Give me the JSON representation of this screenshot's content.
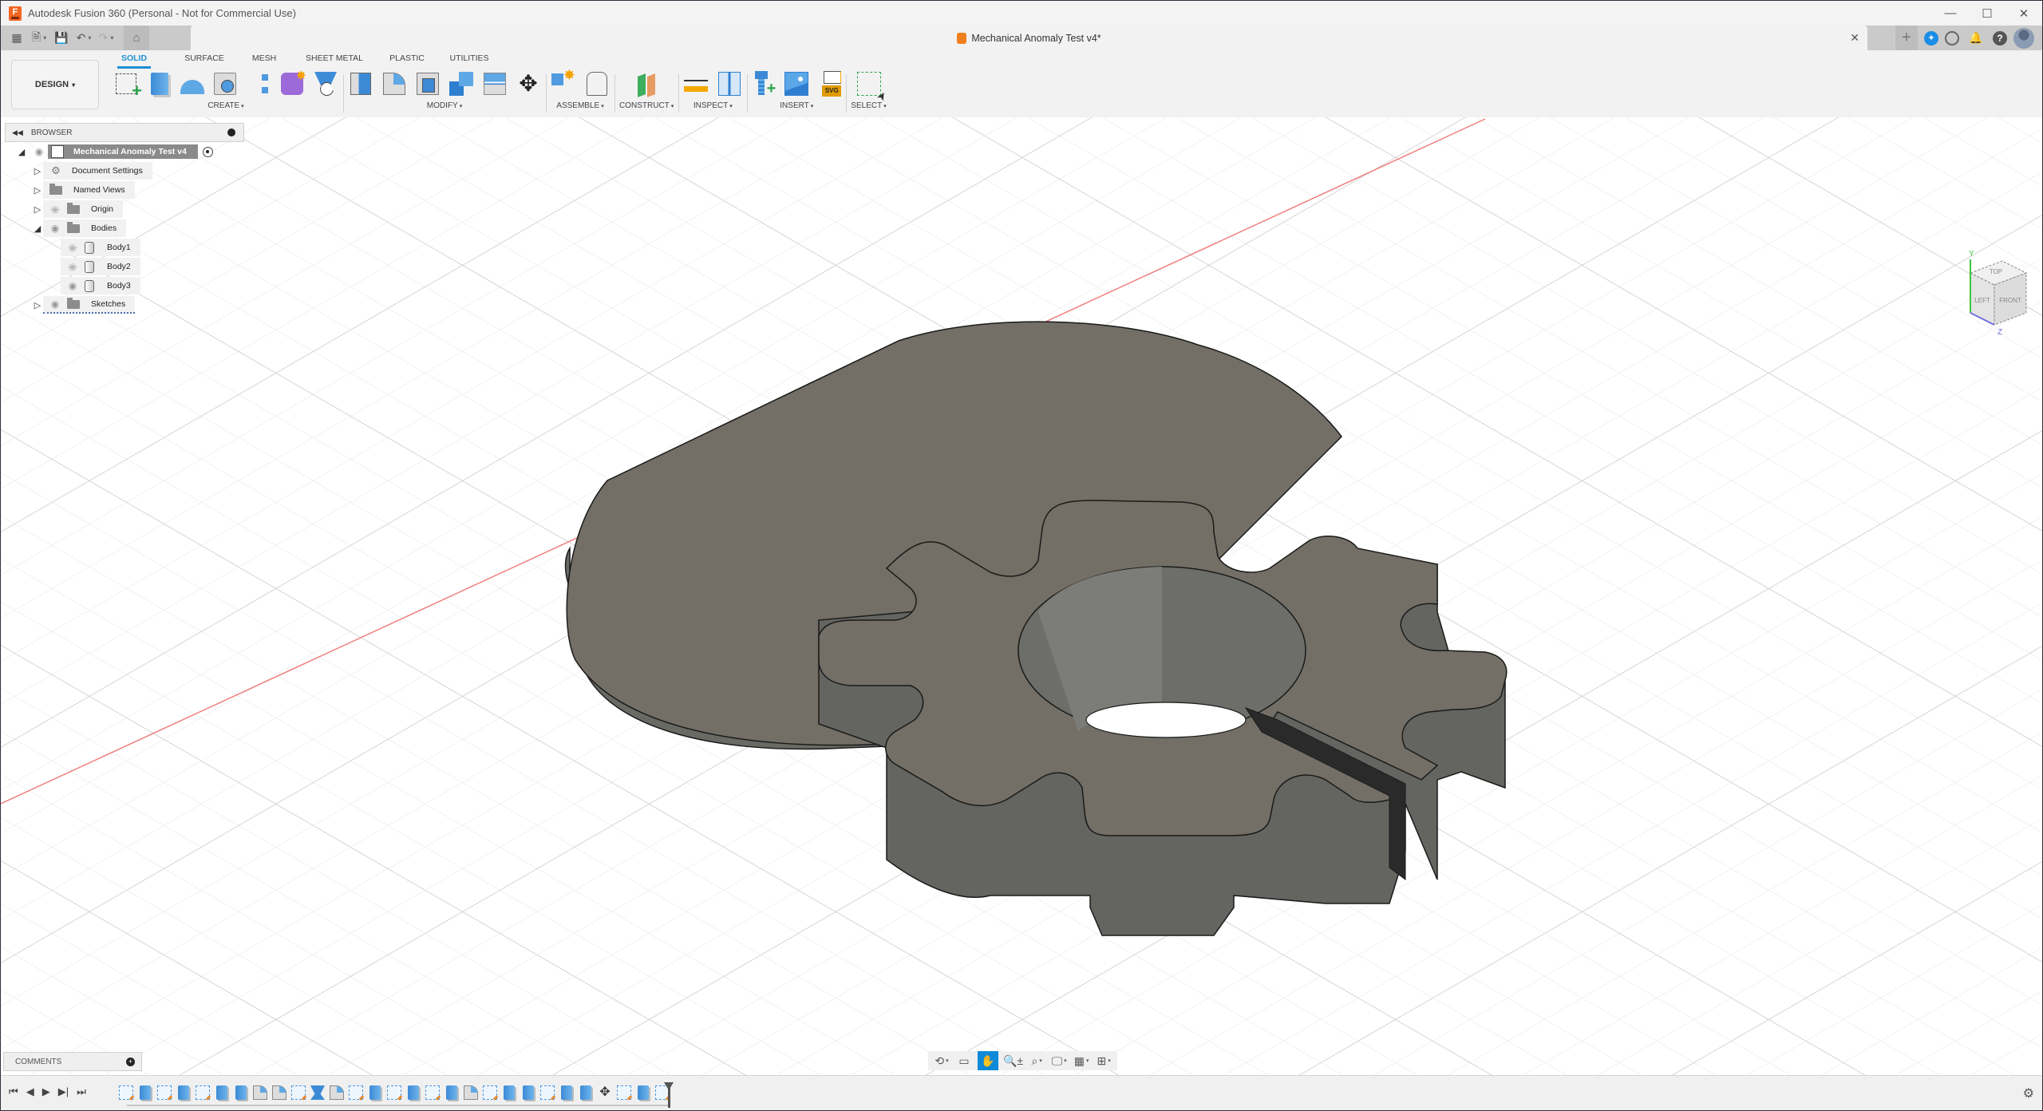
{
  "app": {
    "title": "Autodesk Fusion 360 (Personal - Not for Commercial Use)",
    "logo_letter": "F"
  },
  "window_controls": {
    "minimize": "—",
    "maximize": "☐",
    "close": "✕"
  },
  "qat": {
    "grid_icon": "▦",
    "file_icon": "🗎",
    "save_icon": "💾",
    "undo_icon": "↶",
    "redo_icon": "↷",
    "home_icon": "⌂",
    "dropdown": "▾"
  },
  "document_tab": {
    "title": "Mechanical Anomaly Test v4*",
    "close": "✕"
  },
  "qat_right": {
    "new_tab": "+",
    "extensions": "✦",
    "job_status": "◷",
    "notifications": "🔔",
    "help": "?"
  },
  "workspace": {
    "label": "DESIGN",
    "dropdown": "▾"
  },
  "ribbon_tabs": [
    {
      "label": "SOLID",
      "active": true
    },
    {
      "label": "SURFACE",
      "active": false
    },
    {
      "label": "MESH",
      "active": false
    },
    {
      "label": "SHEET METAL",
      "active": false
    },
    {
      "label": "PLASTIC",
      "active": false
    },
    {
      "label": "UTILITIES",
      "active": false
    }
  ],
  "ribbon_groups": [
    {
      "label": "CREATE",
      "tools": [
        "create-sketch",
        "extrude",
        "revolve",
        "hole",
        "rectangular-pattern",
        "create-form",
        "loft"
      ]
    },
    {
      "label": "MODIFY",
      "tools": [
        "press-pull",
        "fillet",
        "shell",
        "combine",
        "split-body",
        "move-copy"
      ]
    },
    {
      "label": "ASSEMBLE",
      "tools": [
        "new-component",
        "as-built-joint"
      ]
    },
    {
      "label": "CONSTRUCT",
      "tools": [
        "offset-plane"
      ]
    },
    {
      "label": "INSPECT",
      "tools": [
        "measure",
        "section-analysis"
      ]
    },
    {
      "label": "INSERT",
      "tools": [
        "insert-mcmaster-carr",
        "canvas",
        "insert-svg"
      ]
    },
    {
      "label": "SELECT",
      "tools": [
        "window-select"
      ]
    }
  ],
  "browser": {
    "title": "BROWSER",
    "root": {
      "label": "Mechanical Anomaly Test v4",
      "expanded": true,
      "visible": true
    },
    "items": [
      {
        "label": "Document Settings",
        "type": "settings",
        "expanded": false
      },
      {
        "label": "Named Views",
        "type": "folder",
        "expanded": false
      },
      {
        "label": "Origin",
        "type": "folder",
        "expanded": false,
        "visible": false
      },
      {
        "label": "Bodies",
        "type": "folder",
        "expanded": true,
        "visible": true,
        "children": [
          {
            "label": "Body1",
            "visible": false
          },
          {
            "label": "Body2",
            "visible": false
          },
          {
            "label": "Body3",
            "visible": true
          }
        ]
      },
      {
        "label": "Sketches",
        "type": "folder",
        "expanded": false,
        "visible": true
      }
    ]
  },
  "viewcube": {
    "top": "TOP",
    "left": "LEFT",
    "front": "FRONT",
    "axis_y": "Y",
    "axis_z": "Z"
  },
  "comments": {
    "label": "COMMENTS",
    "add": "+"
  },
  "nav_toolbar": {
    "tools": [
      {
        "name": "orbit",
        "glyph": "⟲",
        "dropdown": true,
        "active": false
      },
      {
        "name": "look-at",
        "glyph": "▭",
        "dropdown": false,
        "active": false
      },
      {
        "name": "pan",
        "glyph": "✋",
        "dropdown": false,
        "active": true
      },
      {
        "name": "zoom",
        "glyph": "🔍±",
        "dropdown": false,
        "active": false
      },
      {
        "name": "fit",
        "glyph": "⌕",
        "dropdown": true,
        "active": false
      },
      {
        "name": "display-settings",
        "glyph": "🖵",
        "dropdown": true,
        "active": false
      },
      {
        "name": "grid-snaps",
        "glyph": "▦",
        "dropdown": true,
        "active": false
      },
      {
        "name": "viewports",
        "glyph": "⊞",
        "dropdown": true,
        "active": false
      }
    ]
  },
  "timeline": {
    "controls": [
      "⏮",
      "◀",
      "▶",
      "▶|",
      "⏭"
    ],
    "features": [
      "sketch",
      "extrude",
      "sketch",
      "extrude",
      "sketch",
      "extrude",
      "extrude",
      "fillet",
      "fillet",
      "sketch",
      "loft",
      "fillet",
      "sketch",
      "extrude",
      "sketch",
      "extrude",
      "sketch",
      "extrude",
      "fillet",
      "sketch",
      "extrude",
      "extrude",
      "sketch",
      "extrude",
      "extrude",
      "move",
      "sketch",
      "extrude",
      "sketch"
    ],
    "settings_icon": "⚙"
  },
  "model": {
    "face_color": "#736f66",
    "side_color": "#6b6b66",
    "edge_color": "#1a1a1a"
  },
  "colors": {
    "accent": "#1e8fd5",
    "x_axis": "#f08080",
    "grid_minor": "#ececec",
    "grid_major": "#c8c8c8"
  }
}
